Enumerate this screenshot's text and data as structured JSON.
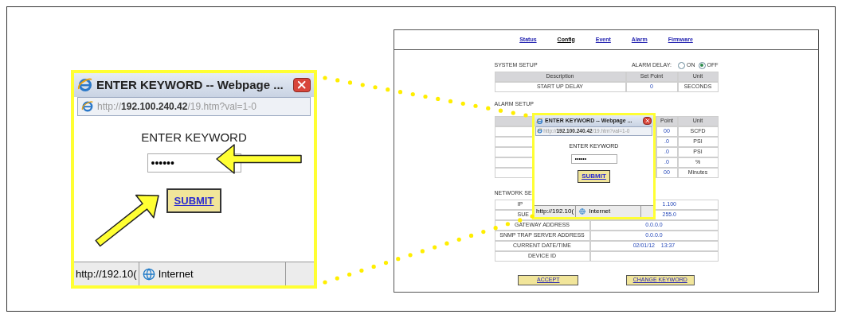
{
  "zoomed_popup": {
    "title": "ENTER KEYWORD -- Webpage ...",
    "address": "http://**192.100.240.42**/19.htm?val=1-0",
    "heading": "ENTER KEYWORD",
    "password": "••••••",
    "submit": "SUBMIT",
    "status_url": "http://192.10(",
    "zone": "Internet"
  },
  "page": {
    "nav": [
      {
        "label": "Status",
        "selected": false
      },
      {
        "label": "Config",
        "selected": true
      },
      {
        "label": "Event",
        "selected": false
      },
      {
        "label": "Alarm",
        "selected": false
      },
      {
        "label": "Firmware",
        "selected": false
      }
    ],
    "system_setup": {
      "title": "SYSTEM SETUP",
      "alarm_delay_label": "ALARM DELAY:",
      "options": [
        {
          "label": "ON",
          "selected": false
        },
        {
          "label": "OFF",
          "selected": true
        }
      ],
      "columns": [
        "Description",
        "Set Point",
        "Unit"
      ],
      "rows": [
        {
          "description": "START UP DELAY",
          "set_point": "0",
          "unit": "SECONDS"
        }
      ]
    },
    "alarm_setup": {
      "title": "ALARM SETUP",
      "columns": [
        "Point",
        "Unit"
      ],
      "rows": [
        {
          "set_point": "00",
          "unit": "SCFD"
        },
        {
          "set_point": ".0",
          "unit": "PSI"
        },
        {
          "set_point": ".0",
          "unit": "PSI"
        },
        {
          "set_point": ".0",
          "unit": "%"
        },
        {
          "set_point": "00",
          "unit": "Minutes"
        }
      ]
    },
    "network_setup": {
      "title": "NETWORK SE",
      "rows": [
        {
          "label": "IP",
          "value": "1.100"
        },
        {
          "label": "SUE",
          "value": "255.0"
        },
        {
          "label": "GATEWAY ADDRESS",
          "value": "0.0.0.0"
        },
        {
          "label": "SNMP TRAP SERVER ADDRESS",
          "value": "0.0.0.0"
        },
        {
          "label": "CURRENT DATE/TIME",
          "value": "02/01/12    13:37"
        },
        {
          "label": "DEVICE ID"
        }
      ]
    },
    "buttons": [
      "ACCEPT",
      "CHANGE KEYWORD"
    ],
    "popup": {
      "title": "ENTER KEYWORD -- Webpage ...",
      "address": "http://**192.100.240.42**/19.htm?val=1-0",
      "heading": "ENTER KEYWORD",
      "password": "••••••",
      "submit": "SUBMIT",
      "status_url": "http://192.10(",
      "zone": "Internet"
    }
  }
}
